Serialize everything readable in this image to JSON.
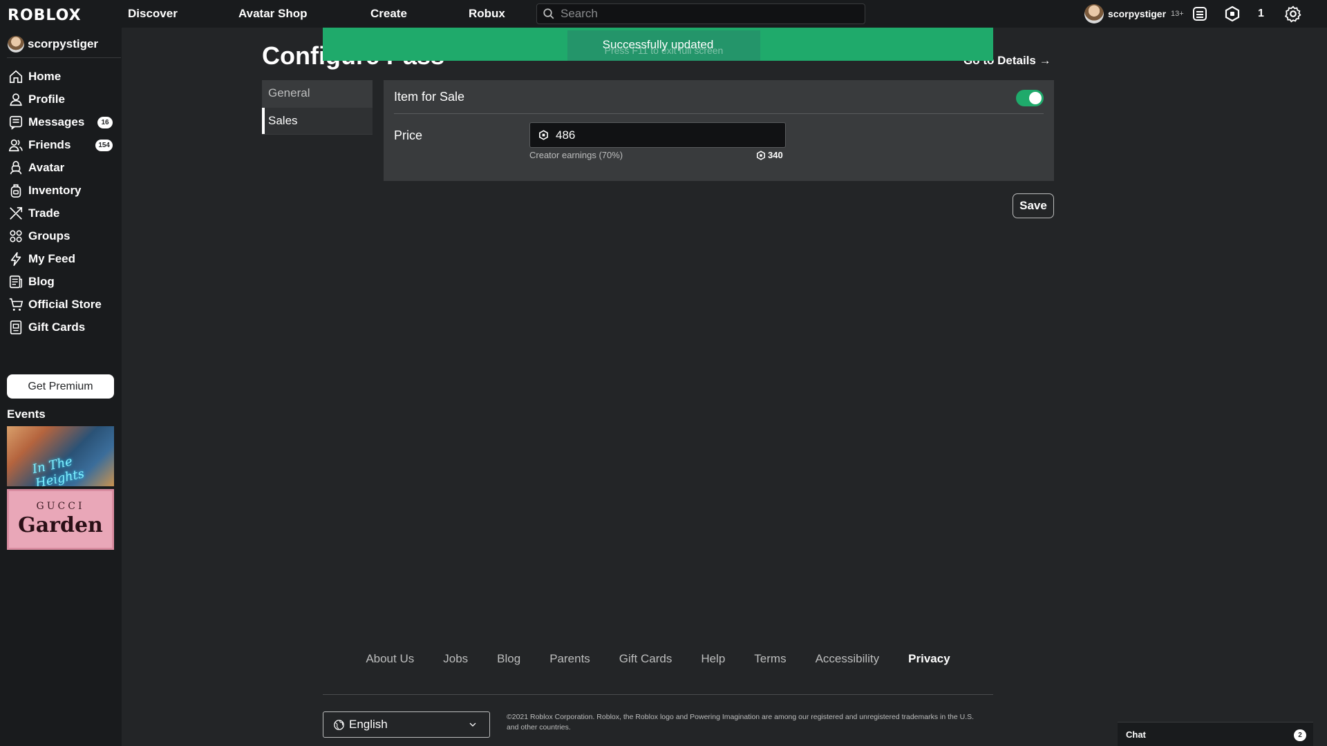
{
  "header": {
    "logo": "ROBLOX",
    "nav": [
      "Discover",
      "Avatar Shop",
      "Create",
      "Robux"
    ],
    "search_placeholder": "Search",
    "username": "scorpystiger",
    "age": "13+",
    "robux_count": "1"
  },
  "sidebar": {
    "username": "scorpystiger",
    "items": [
      {
        "label": "Home",
        "icon": "home-icon"
      },
      {
        "label": "Profile",
        "icon": "profile-icon"
      },
      {
        "label": "Messages",
        "icon": "messages-icon",
        "badge": "16"
      },
      {
        "label": "Friends",
        "icon": "friends-icon",
        "badge": "154"
      },
      {
        "label": "Avatar",
        "icon": "avatar-icon"
      },
      {
        "label": "Inventory",
        "icon": "inventory-icon"
      },
      {
        "label": "Trade",
        "icon": "trade-icon"
      },
      {
        "label": "Groups",
        "icon": "groups-icon"
      },
      {
        "label": "My Feed",
        "icon": "feed-icon"
      },
      {
        "label": "Blog",
        "icon": "blog-icon"
      },
      {
        "label": "Official Store",
        "icon": "store-icon"
      },
      {
        "label": "Gift Cards",
        "icon": "gift-cards-icon"
      }
    ],
    "premium_label": "Get Premium",
    "events_title": "Events",
    "event1_text": "In The Heights",
    "event2_brand": "GUCCI",
    "event2_title": "Garden"
  },
  "toast": {
    "message": "Successfully updated",
    "fullscreen_hint": "Press  F11  to exit full screen"
  },
  "main": {
    "title": "Configure Pass",
    "goto_details": "Go to Details",
    "tabs": [
      "General",
      "Sales"
    ],
    "active_tab": "Sales",
    "item_for_sale_label": "Item for Sale",
    "item_for_sale_on": true,
    "price_label": "Price",
    "price_value": "486",
    "earnings_label": "Creator earnings (70%)",
    "earnings_value": "340",
    "save_label": "Save"
  },
  "footer": {
    "links": [
      "About Us",
      "Jobs",
      "Blog",
      "Parents",
      "Gift Cards",
      "Help",
      "Terms",
      "Accessibility",
      "Privacy"
    ],
    "language": "English",
    "copyright": "©2021 Roblox Corporation. Roblox, the Roblox logo and Powering Imagination are among our registered and unregistered trademarks in the U.S. and other countries."
  },
  "chat": {
    "label": "Chat",
    "count": "2"
  },
  "colors": {
    "accent_green": "#1faa6b",
    "background": "#232527",
    "panel": "#393b3d",
    "topbar": "#191b1d"
  }
}
